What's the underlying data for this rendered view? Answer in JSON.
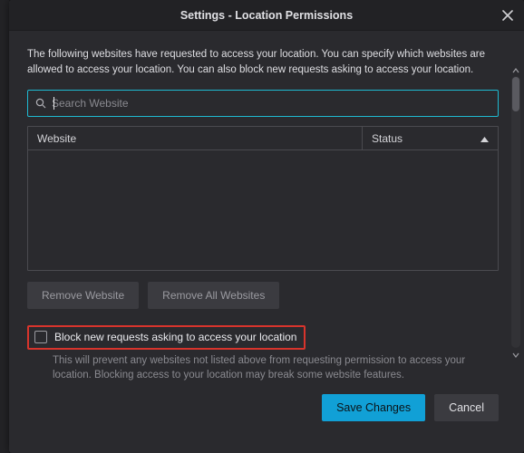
{
  "dialog": {
    "title": "Settings - Location Permissions",
    "intro": "The following websites have requested to access your location. You can specify which websites are allowed to access your location. You can also block new requests asking to access your location.",
    "search_placeholder": "Search Website",
    "table": {
      "col_website": "Website",
      "col_status": "Status"
    },
    "buttons": {
      "remove_website": "Remove Website",
      "remove_all": "Remove All Websites",
      "save": "Save Changes",
      "cancel": "Cancel"
    },
    "block_checkbox": {
      "checked": false,
      "label": "Block new requests asking to access your location"
    },
    "hint": "This will prevent any websites not listed above from requesting permission to access your location. Blocking access to your location may break some website features."
  },
  "colors": {
    "accent": "#1fb9d1",
    "primary_btn": "#11a0d6",
    "highlight": "#d8342c"
  }
}
